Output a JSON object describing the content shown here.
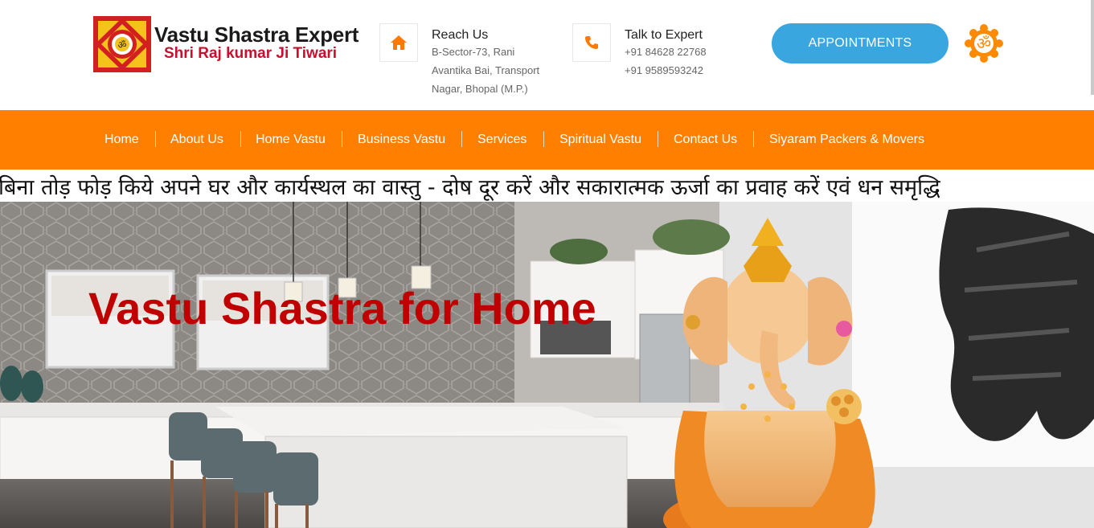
{
  "brand": {
    "title": "Vastu Shastra Expert",
    "subtitle": "Shri Raj kumar Ji Tiwari"
  },
  "reach": {
    "title": "Reach Us",
    "lines": [
      "B-Sector-73, Rani",
      "Avantika Bai, Transport",
      "Nagar, Bhopal (M.P.)"
    ],
    "icon": "home-icon"
  },
  "talk": {
    "title": "Talk to Expert",
    "lines": [
      "+91 84628 22768",
      "+91 9589593242"
    ],
    "icon": "phone-icon"
  },
  "appointments_label": "APPOINTMENTS",
  "nav": {
    "items": [
      "Home",
      "About Us",
      "Home Vastu",
      "Business Vastu",
      "Services",
      "Spiritual Vastu",
      "Contact Us",
      "Siyaram Packers & Movers"
    ]
  },
  "marquee_text": "बिना तोड़ फोड़ किये अपने घर और कार्यस्थल का वास्तु - दोष दूर करें और सकारात्मक ऊर्जा का प्रवाह करें एवं धन समृद्धि",
  "hero": {
    "heading": "Vastu Shastra for Home"
  },
  "colors": {
    "nav_bg": "#ff8000",
    "accent_orange": "#ff8000",
    "button_blue": "#3aa6e0",
    "hero_heading": "#c00000",
    "brand_red": "#c8102e"
  }
}
